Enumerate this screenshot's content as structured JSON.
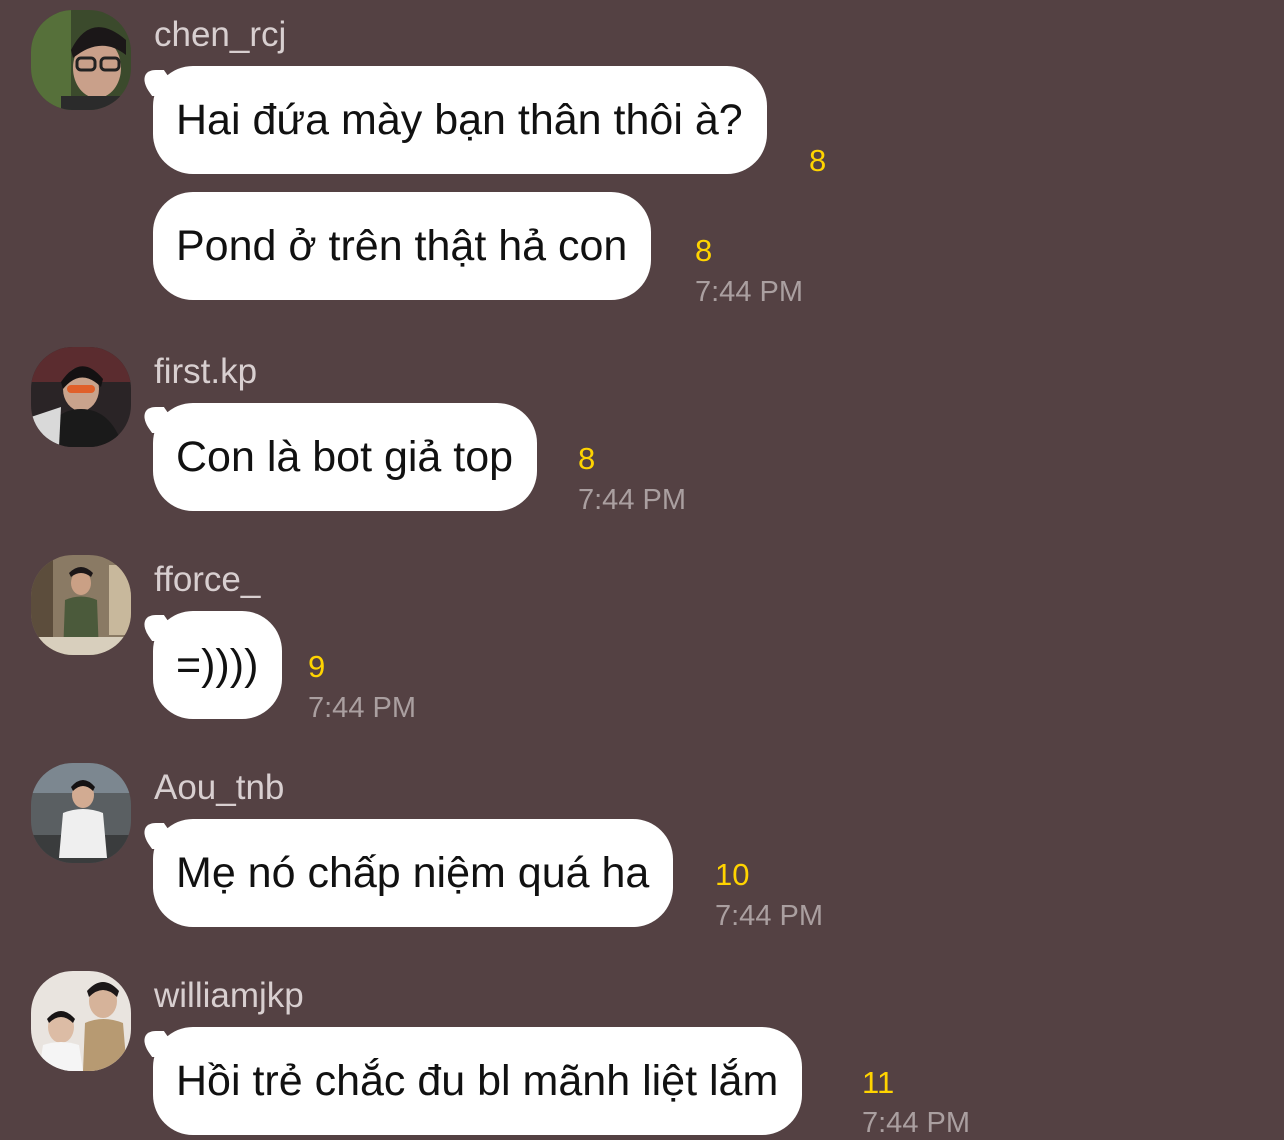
{
  "messages": [
    {
      "username": "chen_rcj",
      "avatar": "avatar-chen_rcj",
      "bubbles": [
        {
          "text": "Hai đứa mày bạn thân thôi à?",
          "read_count": "8",
          "time": ""
        },
        {
          "text": "Pond ở trên thật hả con",
          "read_count": "8",
          "time": "7:44 PM"
        }
      ]
    },
    {
      "username": "first.kp",
      "avatar": "avatar-first.kp",
      "bubbles": [
        {
          "text": "Con là bot giả top",
          "read_count": "8",
          "time": "7:44 PM"
        }
      ]
    },
    {
      "username": "fforce_",
      "avatar": "avatar-fforce_",
      "bubbles": [
        {
          "text": "=))))",
          "read_count": "9",
          "time": "7:44 PM"
        }
      ]
    },
    {
      "username": "Aou_tnb",
      "avatar": "avatar-Aou_tnb",
      "bubbles": [
        {
          "text": "Mẹ nó chấp niệm quá ha",
          "read_count": "10",
          "time": "7:44 PM"
        }
      ]
    },
    {
      "username": "williamjkp",
      "avatar": "avatar-williamjkp",
      "bubbles": [
        {
          "text": "Hồi trẻ chắc đu bl mãnh liệt lắm",
          "read_count": "11",
          "time": "7:44 PM"
        }
      ]
    }
  ],
  "colors": {
    "background": "#544143",
    "bubble": "#ffffff",
    "read_count": "#ffd400",
    "timestamp": "#aa9fa0",
    "username": "#d8cfd0"
  }
}
